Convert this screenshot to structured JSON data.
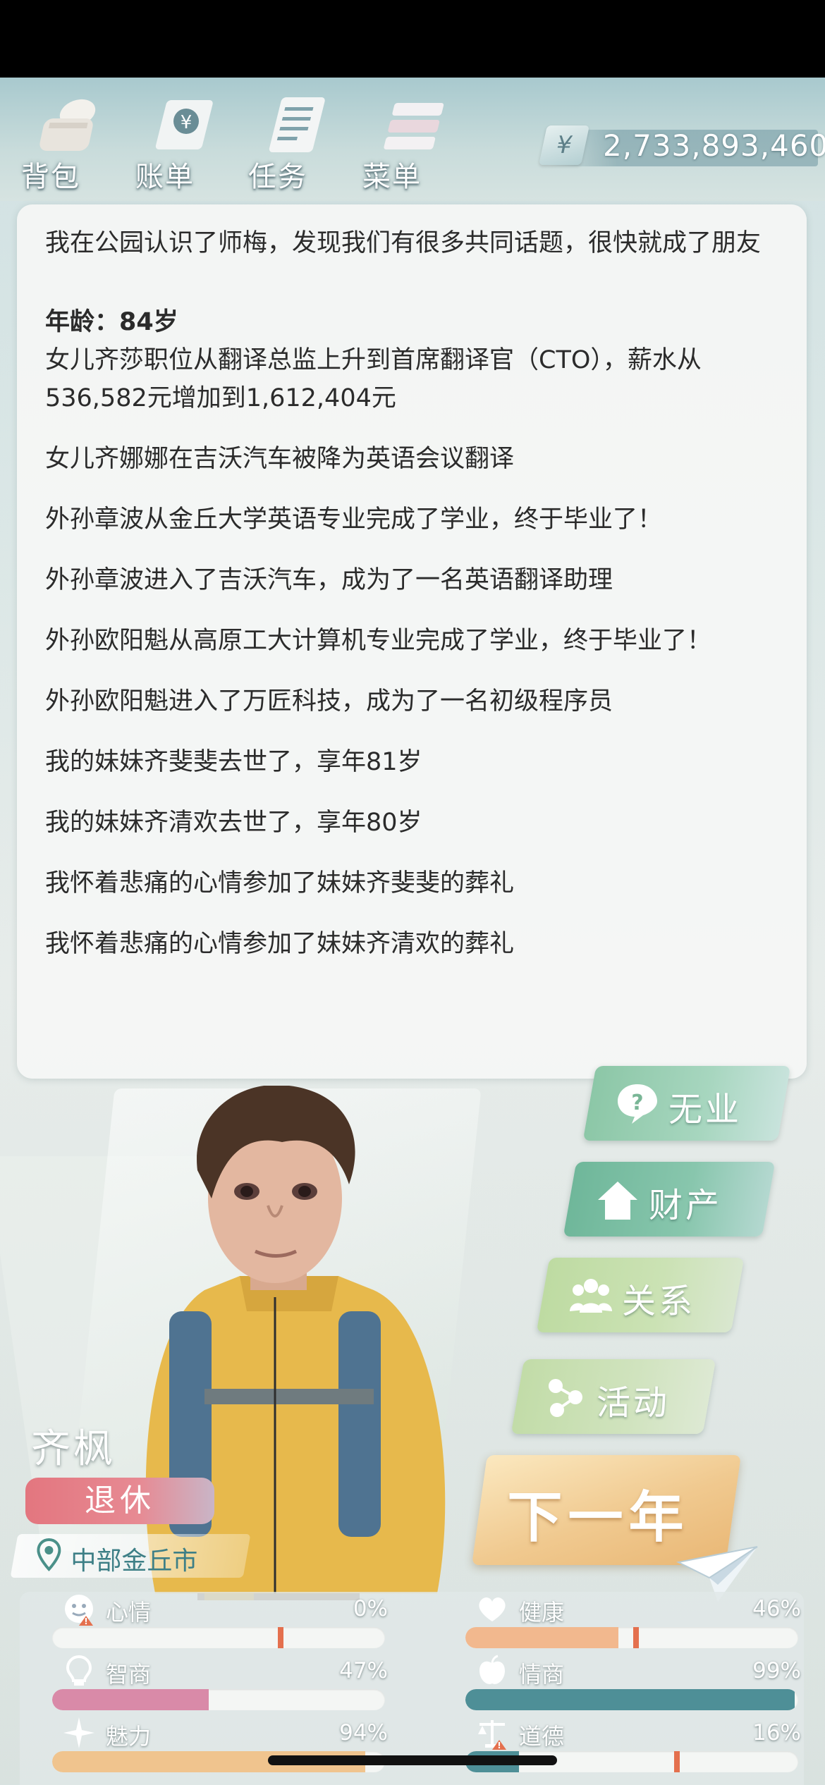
{
  "nav": {
    "items": [
      {
        "label": "背包",
        "icon": "backpack-icon"
      },
      {
        "label": "账单",
        "icon": "bill-icon"
      },
      {
        "label": "任务",
        "icon": "task-icon"
      },
      {
        "label": "菜单",
        "icon": "menu-icon"
      }
    ],
    "money": {
      "currency": "¥",
      "value": "2,733,893,460"
    }
  },
  "log": {
    "first_entry": "我在公园认识了师梅，发现我们有很多共同话题，很快就成了朋友",
    "age": "年龄：84岁",
    "entries": [
      "女儿齐莎职位从翻译总监上升到首席翻译官（CTO），薪水从536,582元增加到1,612,404元",
      "女儿齐娜娜在吉沃汽车被降为英语会议翻译",
      "外孙章波从金丘大学英语专业完成了学业，终于毕业了！",
      "外孙章波进入了吉沃汽车，成为了一名英语翻译助理",
      "外孙欧阳魁从高原工大计算机专业完成了学业，终于毕业了！",
      "外孙欧阳魁进入了万匠科技，成为了一名初级程序员",
      "我的妹妹齐斐斐去世了，享年81岁",
      "我的妹妹齐清欢去世了，享年80岁",
      "我怀着悲痛的心情参加了妹妹齐斐斐的葬礼",
      "我怀着悲痛的心情参加了妹妹齐清欢的葬礼"
    ]
  },
  "actions": {
    "job": "无业",
    "property": "财产",
    "relations": "关系",
    "activity": "活动",
    "next_year": "下一年"
  },
  "character": {
    "name": "齐枫",
    "status": "退休",
    "location": "中部金丘市"
  },
  "stats": [
    {
      "label": "心情",
      "value": "0%",
      "fraction": 0.0,
      "color": "#f2b88e",
      "icon": "mood-face-icon",
      "warning": true
    },
    {
      "label": "健康",
      "value": "46%",
      "fraction": 0.46,
      "color": "#f2b88e",
      "icon": "health-heart-icon",
      "warning": false
    },
    {
      "label": "智商",
      "value": "47%",
      "fraction": 0.47,
      "color": "#d98aa8",
      "icon": "iq-bulb-icon",
      "warning": false
    },
    {
      "label": "情商",
      "value": "99%",
      "fraction": 0.99,
      "color": "#4e8f97",
      "icon": "eq-apple-icon",
      "warning": false
    },
    {
      "label": "魅力",
      "value": "94%",
      "fraction": 0.94,
      "color": "#f0c48e",
      "icon": "charm-star-icon",
      "warning": false
    },
    {
      "label": "道德",
      "value": "16%",
      "fraction": 0.16,
      "color": "#4e8f97",
      "icon": "morality-scale-icon",
      "warning": true
    }
  ]
}
